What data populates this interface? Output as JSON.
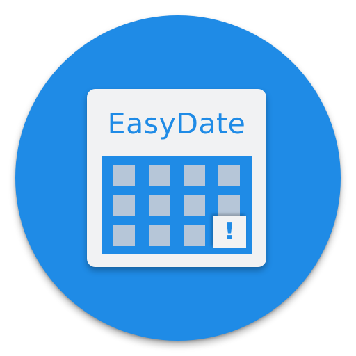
{
  "app": {
    "name": "EasyDate"
  },
  "icons": {
    "calendar": "calendar-icon",
    "alert": "exclamation-icon",
    "alert_glyph": "!"
  },
  "colors": {
    "primary_blue": "#1f8be6",
    "card_background": "#f1f2f3",
    "cell_gray": "#b6c6d8"
  },
  "calendar": {
    "rows": 3,
    "columns": 4,
    "alert_position": "bottom-right"
  }
}
